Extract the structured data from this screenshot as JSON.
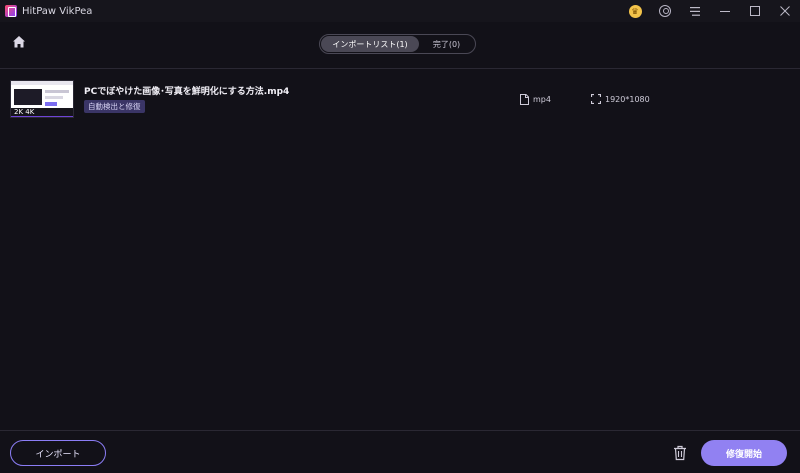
{
  "app": {
    "title": "HitPaw VikPea"
  },
  "tabs": [
    {
      "label": "インポートリスト(1)",
      "active": true
    },
    {
      "label": "完了(0)",
      "active": false
    }
  ],
  "files": [
    {
      "thumbnail_text": "2K 4K",
      "name": "PCでぼやけた画像･写真を鮮明化にする方法.mp4",
      "tag": "自動検出と修復",
      "format": "mp4",
      "resolution": "1920*1080"
    }
  ],
  "footer": {
    "import_label": "インポート",
    "start_label": "修復開始"
  },
  "icons": {
    "window_controls": [
      "premium-icon",
      "account-icon",
      "menu-icon",
      "minimize-icon",
      "maximize-icon",
      "close-icon"
    ],
    "header": "home-icon",
    "row": [
      "file-icon",
      "resolution-icon"
    ],
    "footer": "trash-icon"
  },
  "colors": {
    "background": "#121118",
    "accent": "#9181f2",
    "tag_bg": "#3a3566",
    "premium": "#f3c34a"
  }
}
